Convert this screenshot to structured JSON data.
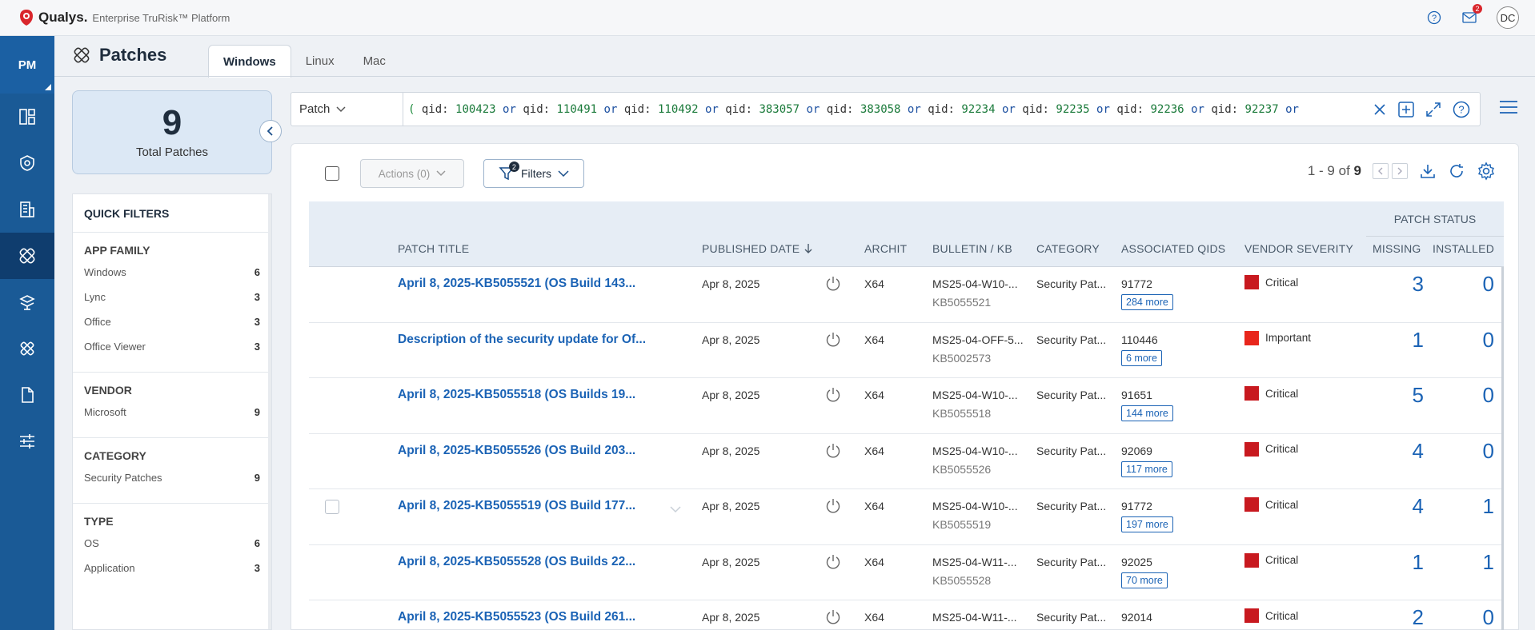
{
  "topbar": {
    "brand": "Qualys.",
    "product": "Enterprise TruRisk™ Platform",
    "notification_count": "2",
    "user_initials": "DC"
  },
  "rail": {
    "module": "PM"
  },
  "page": {
    "title": "Patches",
    "tabs": [
      "Windows",
      "Linux",
      "Mac"
    ]
  },
  "summary": {
    "count": "9",
    "label": "Total Patches"
  },
  "quick_filters": {
    "title": "QUICK FILTERS",
    "sections": [
      {
        "heading": "APP FAMILY",
        "items": [
          {
            "label": "Windows",
            "count": "6"
          },
          {
            "label": "Lync",
            "count": "3"
          },
          {
            "label": "Office",
            "count": "3"
          },
          {
            "label": "Office Viewer",
            "count": "3"
          }
        ]
      },
      {
        "heading": "VENDOR",
        "items": [
          {
            "label": "Microsoft",
            "count": "9"
          }
        ]
      },
      {
        "heading": "CATEGORY",
        "items": [
          {
            "label": "Security Patches",
            "count": "9"
          }
        ]
      },
      {
        "heading": "TYPE",
        "items": [
          {
            "label": "OS",
            "count": "6"
          },
          {
            "label": "Application",
            "count": "3"
          }
        ]
      }
    ]
  },
  "search": {
    "type": "Patch",
    "query_values": [
      "100423",
      "110491",
      "110492",
      "383057",
      "383058",
      "92234",
      "92235",
      "92236",
      "92237"
    ],
    "query_key": "qid:",
    "query_op": "or",
    "query_open": "("
  },
  "toolbar": {
    "actions_label": "Actions (0)",
    "filters_label": "Filters",
    "filters_count": "2",
    "pager_range": "1 - 9 of",
    "pager_total": "9"
  },
  "table": {
    "group_header": "PATCH STATUS",
    "columns": {
      "title": "PATCH TITLE",
      "published": "PUBLISHED DATE",
      "arch": "ARCHIT",
      "bulletin": "BULLETIN / KB",
      "category": "CATEGORY",
      "qids": "ASSOCIATED QIDS",
      "severity": "VENDOR SEVERITY",
      "missing": "MISSING",
      "installed": "INSTALLED"
    },
    "rows": [
      {
        "title": "April 8, 2025-KB5055521 (OS Build 143...",
        "date": "Apr 8, 2025",
        "arch": "X64",
        "bulletin": "MS25-04-W10-...",
        "kb": "KB5055521",
        "category": "Security Pat...",
        "qid": "91772",
        "more": "284 more",
        "severity": "Critical",
        "sev_color": "#c8191f",
        "missing": "3",
        "installed": "0"
      },
      {
        "title": "Description of the security update for Of...",
        "date": "Apr 8, 2025",
        "arch": "X64",
        "bulletin": "MS25-04-OFF-5...",
        "kb": "KB5002573",
        "category": "Security Pat...",
        "qid": "110446",
        "more": "6 more",
        "severity": "Important",
        "sev_color": "#e8261c",
        "missing": "1",
        "installed": "0"
      },
      {
        "title": "April 8, 2025-KB5055518 (OS Builds 19...",
        "date": "Apr 8, 2025",
        "arch": "X64",
        "bulletin": "MS25-04-W10-...",
        "kb": "KB5055518",
        "category": "Security Pat...",
        "qid": "91651",
        "more": "144 more",
        "severity": "Critical",
        "sev_color": "#c8191f",
        "missing": "5",
        "installed": "0"
      },
      {
        "title": "April 8, 2025-KB5055526 (OS Build 203...",
        "date": "Apr 8, 2025",
        "arch": "X64",
        "bulletin": "MS25-04-W10-...",
        "kb": "KB5055526",
        "category": "Security Pat...",
        "qid": "92069",
        "more": "117 more",
        "severity": "Critical",
        "sev_color": "#c8191f",
        "missing": "4",
        "installed": "0"
      },
      {
        "title": "April 8, 2025-KB5055519 (OS Build 177...",
        "date": "Apr 8, 2025",
        "arch": "X64",
        "bulletin": "MS25-04-W10-...",
        "kb": "KB5055519",
        "category": "Security Pat...",
        "qid": "91772",
        "more": "197 more",
        "severity": "Critical",
        "sev_color": "#c8191f",
        "missing": "4",
        "installed": "1"
      },
      {
        "title": "April 8, 2025-KB5055528 (OS Builds 22...",
        "date": "Apr 8, 2025",
        "arch": "X64",
        "bulletin": "MS25-04-W11-...",
        "kb": "KB5055528",
        "category": "Security Pat...",
        "qid": "92025",
        "more": "70 more",
        "severity": "Critical",
        "sev_color": "#c8191f",
        "missing": "1",
        "installed": "1"
      },
      {
        "title": "April 8, 2025-KB5055523 (OS Build 261...",
        "date": "Apr 8, 2025",
        "arch": "X64",
        "bulletin": "MS25-04-W11-...",
        "kb": "",
        "category": "Security Pat...",
        "qid": "92014",
        "more": "",
        "severity": "Critical",
        "sev_color": "#c8191f",
        "missing": "2",
        "installed": "0"
      }
    ]
  }
}
